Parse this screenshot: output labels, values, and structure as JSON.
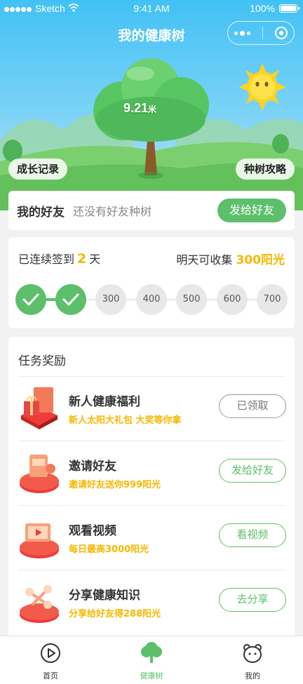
{
  "status_bar": {
    "carrier": "Sketch",
    "time": "9:41 AM",
    "battery": "100%"
  },
  "header": {
    "title": "我的健康树"
  },
  "tree": {
    "height_value": "9.21",
    "height_unit": "米"
  },
  "hero_buttons": {
    "growth_record": "成长记录",
    "planting_guide": "种树攻略"
  },
  "friends": {
    "label": "我的好友",
    "hint": "还没有好友种树",
    "button": "发给好友"
  },
  "signin": {
    "prefix": "已连续签到",
    "days": "2",
    "suffix": "天",
    "tomorrow_label": "明天可收集",
    "tomorrow_value": "300阳光",
    "nodes": [
      {
        "label": "",
        "done": true
      },
      {
        "label": "",
        "done": true
      },
      {
        "label": "300",
        "done": false
      },
      {
        "label": "400",
        "done": false
      },
      {
        "label": "500",
        "done": false
      },
      {
        "label": "600",
        "done": false
      },
      {
        "label": "700",
        "done": false
      }
    ]
  },
  "tasks": {
    "header": "任务奖励",
    "items": [
      {
        "title": "新人健康福利",
        "subtitle": "新人太阳大礼包 大奖等你拿",
        "button": "已领取",
        "claimed": true,
        "icon": "gift-icon"
      },
      {
        "title": "邀请好友",
        "subtitle": "邀请好友送你999阳光",
        "button": "发给好友",
        "claimed": false,
        "icon": "invite-icon"
      },
      {
        "title": "观看视频",
        "subtitle": "每日最高3000阳光",
        "button": "看视频",
        "claimed": false,
        "icon": "video-icon"
      },
      {
        "title": "分享健康知识",
        "subtitle": "分享给好友得288阳光",
        "button": "去分享",
        "claimed": false,
        "icon": "share-icon"
      }
    ]
  },
  "tabbar": {
    "items": [
      {
        "label": "首页",
        "icon": "play-circle-icon",
        "active": false
      },
      {
        "label": "健康树",
        "icon": "tree-icon",
        "active": true
      },
      {
        "label": "我的",
        "icon": "bear-face-icon",
        "active": false
      }
    ]
  },
  "colors": {
    "accent_green": "#5dbf6b",
    "sun_yellow": "#f5b800",
    "sky_blue": "#42c1f5"
  }
}
